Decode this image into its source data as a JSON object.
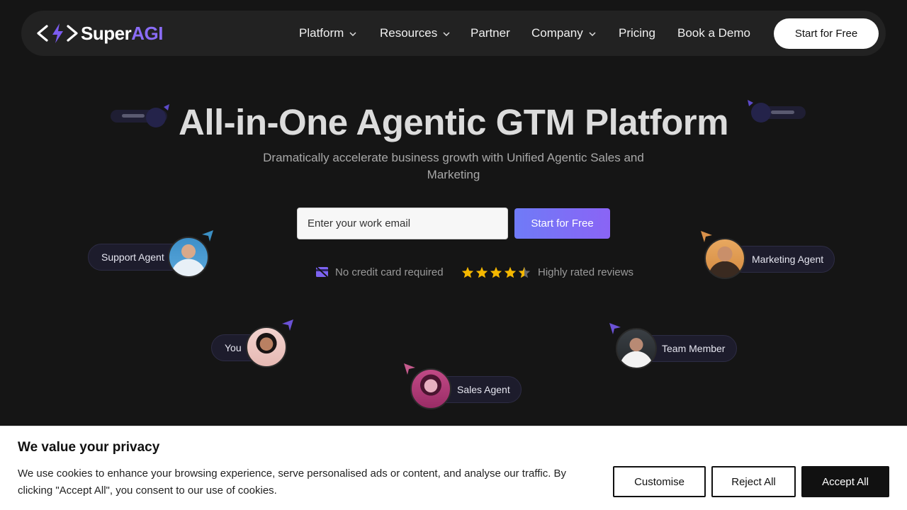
{
  "nav": {
    "logo_super": "Super",
    "logo_agi": "AGI",
    "items": [
      {
        "label": "Platform",
        "dropdown": true
      },
      {
        "label": "Resources",
        "dropdown": true
      },
      {
        "label": "Partner",
        "dropdown": false
      },
      {
        "label": "Company",
        "dropdown": true
      },
      {
        "label": "Pricing",
        "dropdown": false
      },
      {
        "label": "Book a Demo",
        "dropdown": false
      }
    ],
    "cta": "Start for Free"
  },
  "hero": {
    "title": "All-in-One Agentic GTM Platform",
    "subtitle": "Dramatically accelerate business growth with Unified Agentic Sales and Marketing",
    "email_placeholder": "Enter your work email",
    "cta": "Start for Free",
    "trust_1": "No credit card required",
    "trust_2": "Highly rated reviews",
    "rating_stars": 4.5
  },
  "agents": {
    "support": "Support Agent",
    "marketing": "Marketing Agent",
    "you": "You",
    "team": "Team Member",
    "sales": "Sales Agent"
  },
  "cookie": {
    "title": "We value your privacy",
    "text": "We use cookies to enhance your browsing experience, serve personalised ads or content, and analyse our traffic. By clicking \"Accept All\", you consent to our use of cookies.",
    "customise": "Customise",
    "reject": "Reject All",
    "accept": "Accept All"
  },
  "colors": {
    "background": "#151515",
    "accent": "#8a64f5",
    "star": "#f5b800"
  }
}
